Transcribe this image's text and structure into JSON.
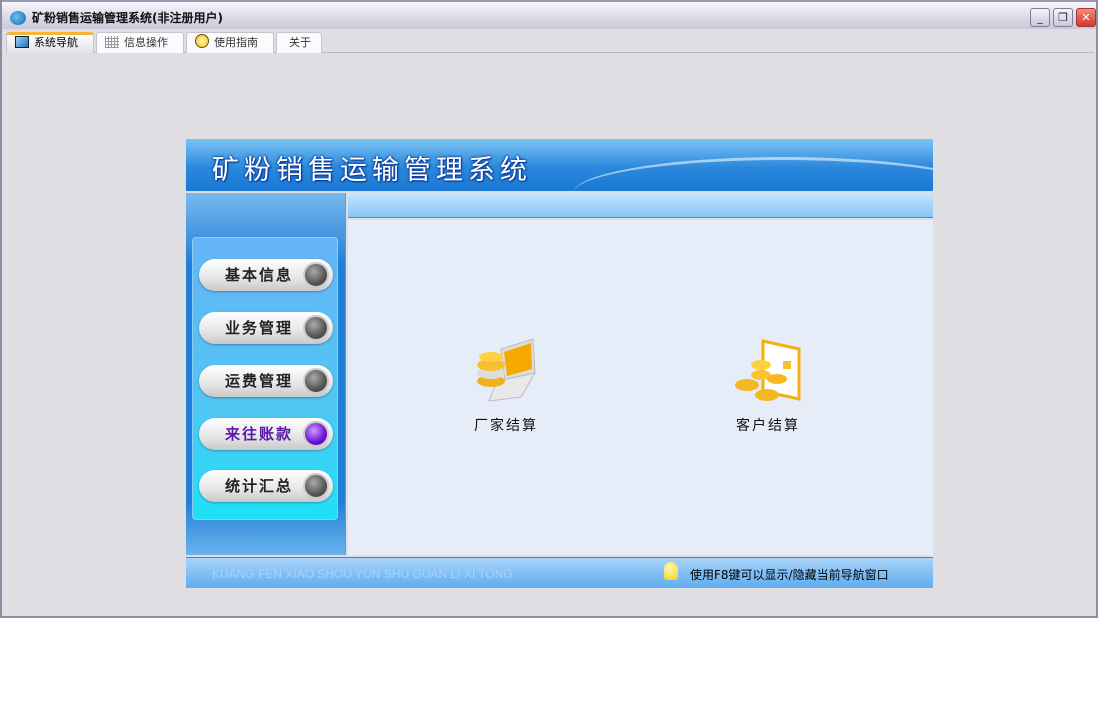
{
  "window": {
    "title": "矿粉销售运输管理系统(非注册用户)",
    "controls": {
      "minimize": "_",
      "restore": "❐",
      "close": "✕"
    }
  },
  "tabs": [
    {
      "label": "系统导航",
      "icon": "monitor-icon"
    },
    {
      "label": "信息操作",
      "icon": "grid-icon"
    },
    {
      "label": "使用指南",
      "icon": "help-icon"
    },
    {
      "label": "关于"
    }
  ],
  "panel": {
    "title": "矿粉销售运输管理系统",
    "nav": [
      {
        "label": "基本信息"
      },
      {
        "label": "业务管理"
      },
      {
        "label": "运费管理"
      },
      {
        "label": "来往账款",
        "selected": true
      },
      {
        "label": "统计汇总"
      }
    ],
    "items": [
      {
        "label": "厂家结算",
        "icon": "laptop-coins-icon"
      },
      {
        "label": "客户结算",
        "icon": "card-coins-icon"
      }
    ],
    "footer": {
      "pinyin": "KUANG FEN XIAO SHOU YUN SHU GUAN LI XI TONG",
      "hint": "使用F8键可以显示/隐藏当前导航窗口"
    }
  }
}
